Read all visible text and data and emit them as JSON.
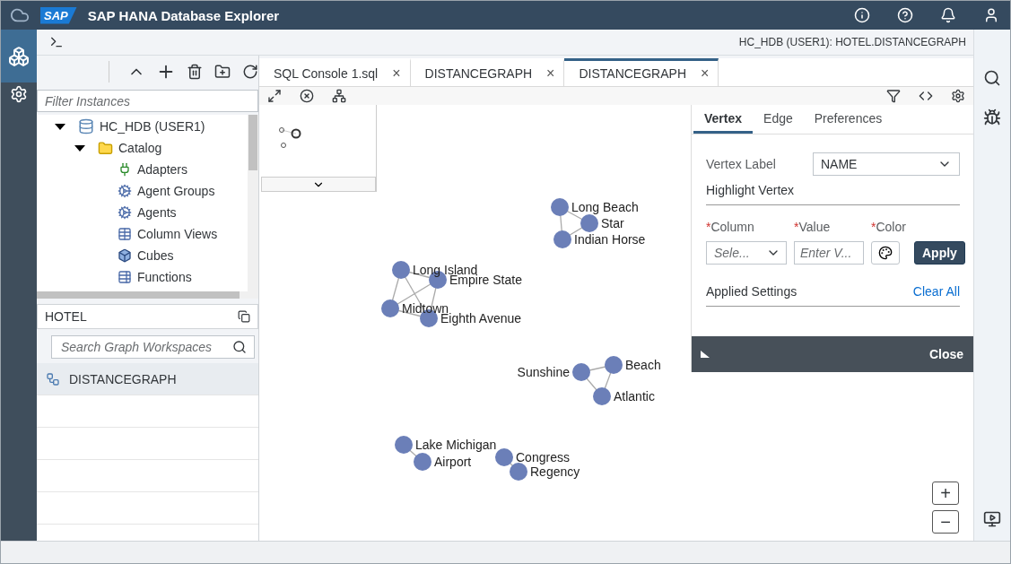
{
  "shell": {
    "logo": "SAP",
    "title": "SAP HANA Database Explorer"
  },
  "rail_items": [
    {
      "kind": "database",
      "selected": true
    },
    {
      "kind": "settings",
      "selected": false
    }
  ],
  "breadcrumb": "HC_HDB (USER1): HOTEL.DISTANCEGRAPH",
  "filter": {
    "placeholder": "Filter Instances"
  },
  "tree": [
    {
      "label": "HC_HDB (USER1)",
      "kind": "database",
      "expanded": true,
      "children": [
        {
          "label": "Catalog",
          "kind": "folder",
          "expanded": true,
          "children": [
            {
              "label": "Adapters",
              "kind": "adapter"
            },
            {
              "label": "Agent Groups",
              "kind": "gear"
            },
            {
              "label": "Agents",
              "kind": "gear"
            },
            {
              "label": "Column Views",
              "kind": "table"
            },
            {
              "label": "Cubes",
              "kind": "cube"
            },
            {
              "label": "Functions",
              "kind": "function"
            }
          ]
        }
      ]
    }
  ],
  "schema": "HOTEL",
  "workspace_search": {
    "placeholder": "Search Graph Workspaces"
  },
  "workspaces": [
    {
      "label": "DISTANCEGRAPH",
      "selected": true
    }
  ],
  "tabs": [
    {
      "label": "SQL Console 1.sql",
      "close": "×",
      "selected": false
    },
    {
      "label": "DISTANCEGRAPH",
      "close": "×",
      "selected": false
    },
    {
      "label": "DISTANCEGRAPH",
      "close": "×",
      "selected": true
    }
  ],
  "graph": {
    "nodes": [
      {
        "label": "Long Beach"
      },
      {
        "label": "Star"
      },
      {
        "label": "Indian Horse"
      },
      {
        "label": "Long Island"
      },
      {
        "label": "Empire State"
      },
      {
        "label": "Midtown"
      },
      {
        "label": "Eighth Avenue"
      },
      {
        "label": "Beach"
      },
      {
        "label": "Sunshine"
      },
      {
        "label": "Atlantic"
      },
      {
        "label": "Lake Michigan"
      },
      {
        "label": "Airport"
      },
      {
        "label": "Congress"
      },
      {
        "label": "Regency"
      }
    ]
  },
  "settings_panel": {
    "tabs": [
      {
        "label": "Vertex",
        "selected": true
      },
      {
        "label": "Edge",
        "selected": false
      },
      {
        "label": "Preferences",
        "selected": false
      }
    ],
    "vertex_label": {
      "label": "Vertex Label",
      "value": "NAME"
    },
    "highlight_title": "Highlight Vertex",
    "fields": [
      {
        "label": "Column",
        "mark": "*",
        "kind": "select",
        "placeholder": "Sele..."
      },
      {
        "label": "Value",
        "mark": "*",
        "kind": "input",
        "placeholder": "Enter V..."
      },
      {
        "label": "Color",
        "mark": "*",
        "kind": "color"
      }
    ],
    "apply": "Apply",
    "applied_title": "Applied Settings",
    "clear_all": "Clear All",
    "close": "Close"
  },
  "zoom": {
    "in": "+",
    "out": "−"
  }
}
